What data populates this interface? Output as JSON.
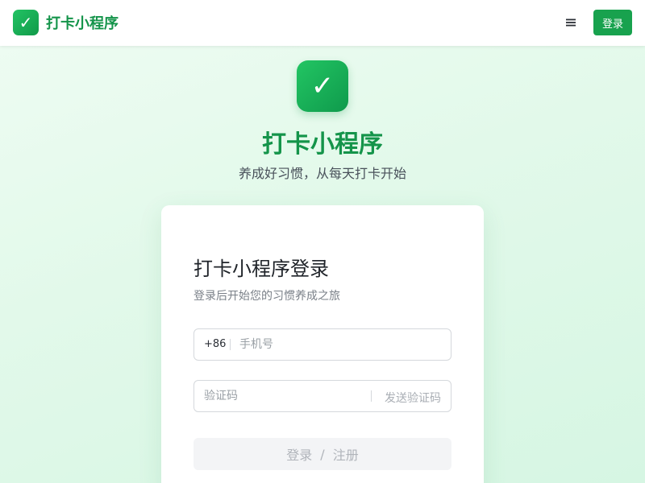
{
  "header": {
    "logo_glyph": "✓",
    "app_name": "打卡小程序",
    "menu_icon": "menu-icon",
    "login_label": "登录"
  },
  "hero": {
    "logo_glyph": "✓",
    "title": "打卡小程序",
    "subtitle": "养成好习惯，从每天打卡开始"
  },
  "card": {
    "title": "打卡小程序登录",
    "description": "登录后开始您的习惯养成之旅",
    "phone": {
      "prefix": "+86",
      "placeholder": "手机号",
      "value": ""
    },
    "code": {
      "placeholder": "验证码",
      "value": "",
      "send_label": "发送验证码"
    },
    "submit": {
      "login": "登录",
      "separator": "/",
      "register": "注册"
    }
  },
  "colors": {
    "brand_green": "#18a24e",
    "title_green": "#14944a",
    "background": "#e2f9ea"
  }
}
